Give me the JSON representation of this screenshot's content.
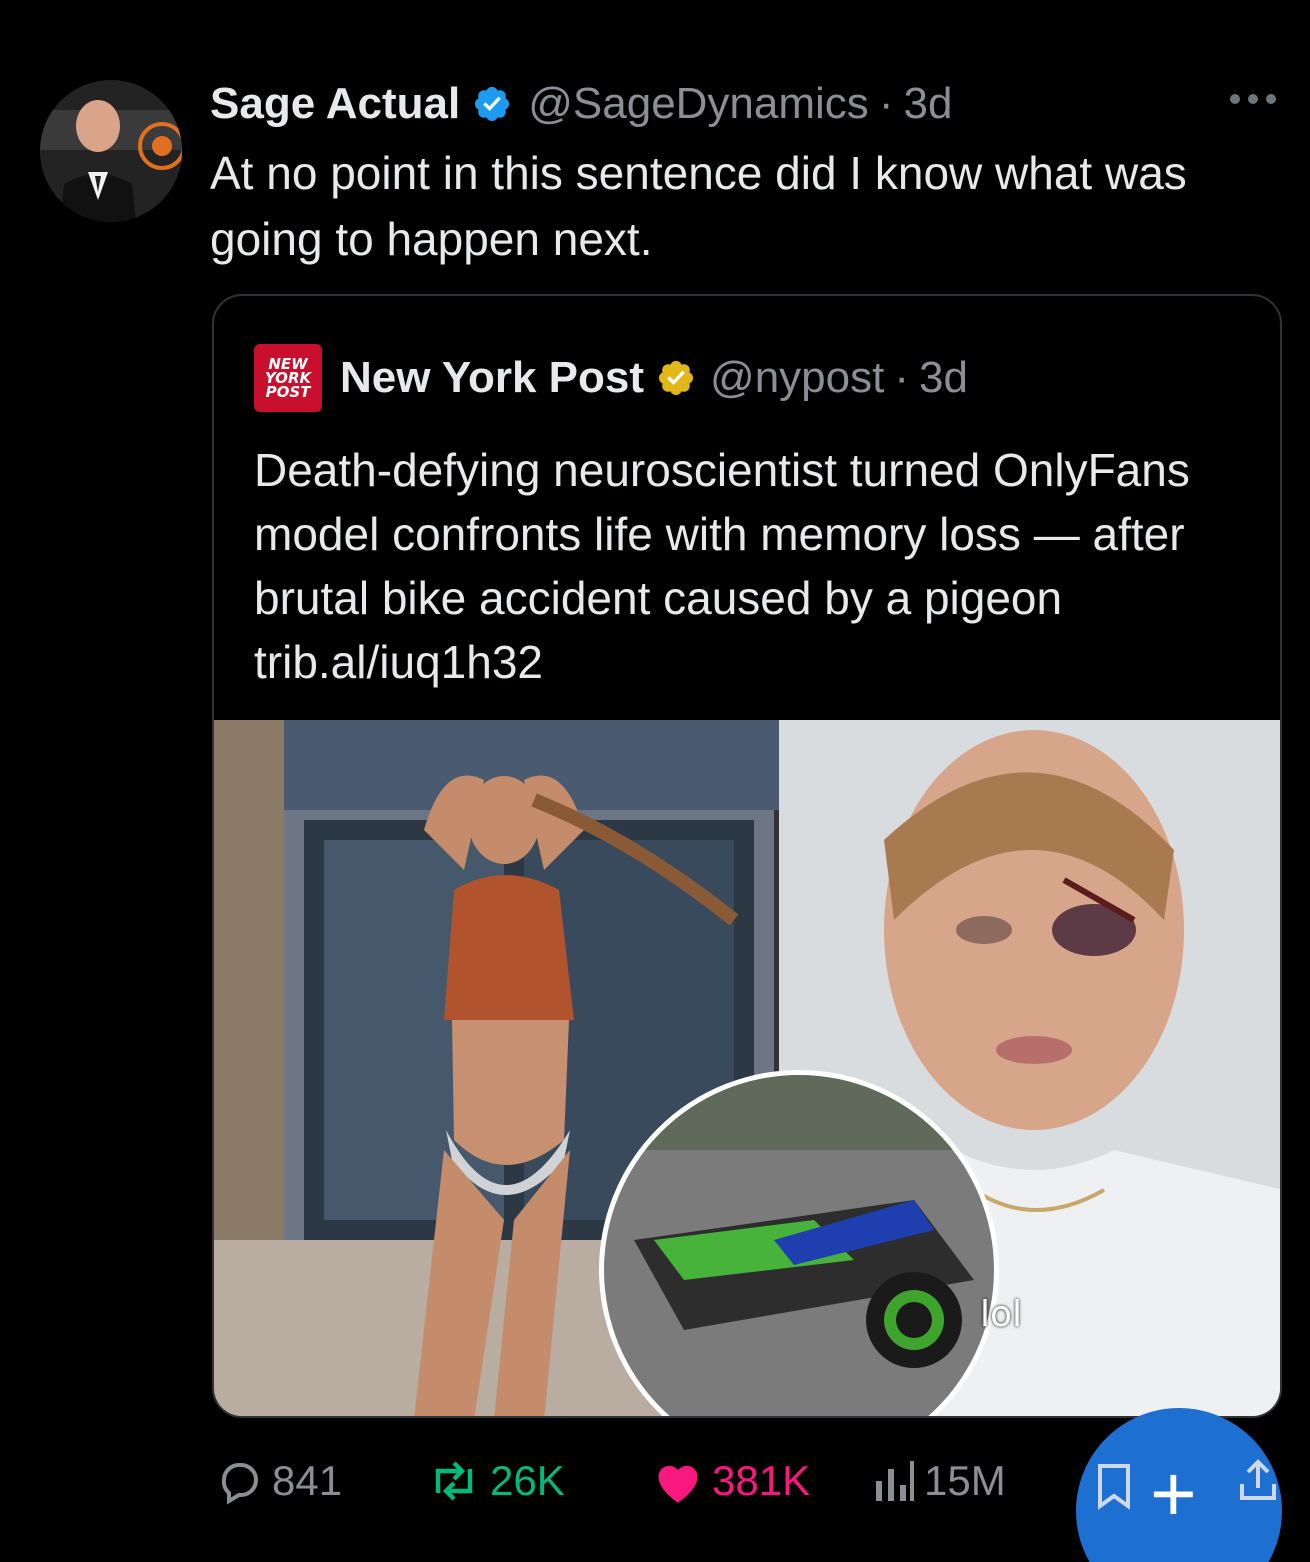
{
  "tweet": {
    "author_name": "Sage Actual",
    "author_handle": "@SageDynamics",
    "separator": "·",
    "time": "3d",
    "text": "At no point in this sentence did I know what was going to happen next."
  },
  "quoted": {
    "logo_lines": [
      "NEW",
      "YORK",
      "POST"
    ],
    "author_name": "New York Post",
    "author_handle": "@nypost",
    "separator": "·",
    "time": "3d",
    "text": "Death-defying neuroscientist turned OnlyFans model confronts life with memory loss — after brutal bike accident caused by a pigeon trib.al/iuq1h32",
    "image_overlay_text": "lol"
  },
  "actions": {
    "replies": "841",
    "retweets": "26K",
    "likes": "381K",
    "views": "15M"
  },
  "colors": {
    "background": "#000000",
    "verified_blue": "#1d9bf0",
    "verified_gold": "#e2b719",
    "retweet_green": "#00ba7c",
    "like_pink": "#f91880",
    "muted": "#8b8f94",
    "fab_blue": "#1d6fd1"
  },
  "icons": {
    "reply": "speech-bubble-icon",
    "retweet": "retweet-arrows-icon",
    "like": "heart-icon",
    "views": "bar-chart-icon",
    "bookmark": "bookmark-icon",
    "share": "share-upload-icon",
    "compose": "plus-icon",
    "more": "ellipsis-icon"
  }
}
